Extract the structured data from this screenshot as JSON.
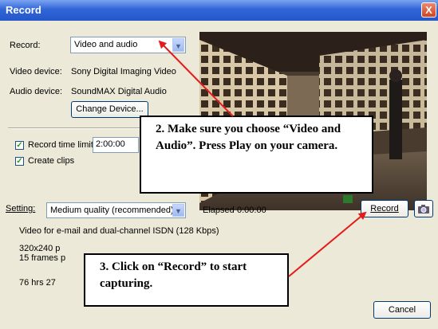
{
  "window": {
    "title": "Record",
    "close_symbol": "X"
  },
  "record": {
    "label": "Record:",
    "selected": "Video and audio"
  },
  "devices": {
    "video_label": "Video device:",
    "video_value": "Sony Digital Imaging Video",
    "audio_label": "Audio device:",
    "audio_value": "SoundMAX Digital Audio",
    "change_button": "Change Device..."
  },
  "options": {
    "time_limit_label": "Record time limit:",
    "time_limit_value": "2:00:00",
    "create_clips_label": "Create clips"
  },
  "setting": {
    "label": "Setting:",
    "selected": "Medium quality (recommended)",
    "elapsed_label": "Elapsed",
    "elapsed_value": "0:00:00",
    "description_line1": "Video for e-mail and dual-channel ISDN (128 Kbps)",
    "resolution": "320x240 p",
    "frames": "15 frames p",
    "remaining": "76 hrs  27"
  },
  "buttons": {
    "record": "Record",
    "cancel": "Cancel",
    "camera_icon": "camera-icon"
  },
  "callouts": {
    "top_text": "2.  Make sure you choose “Video and Audio”.  Press Play on your camera.",
    "bottom_text": "3.  Click on “Record” to start capturing."
  },
  "colors": {
    "title_bar": "#2456c8",
    "arrow": "#e31b1b",
    "dialog": "#ece9d8"
  }
}
